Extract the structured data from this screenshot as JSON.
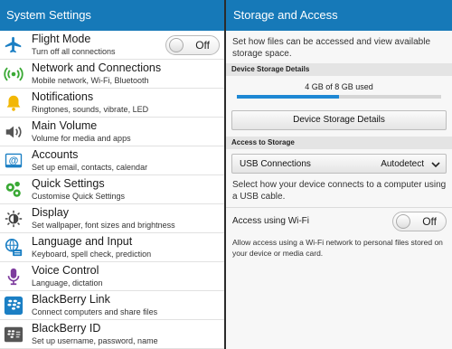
{
  "left_panel": {
    "title": "System Settings",
    "items": [
      {
        "title": "Flight Mode",
        "subtitle": "Turn off all connections",
        "icon": "airplane-icon",
        "toggle": "Off"
      },
      {
        "title": "Network and Connections",
        "subtitle": "Mobile network, Wi-Fi, Bluetooth",
        "icon": "network-icon"
      },
      {
        "title": "Notifications",
        "subtitle": "Ringtones, sounds, vibrate, LED",
        "icon": "bell-icon"
      },
      {
        "title": "Main Volume",
        "subtitle": "Volume for media and apps",
        "icon": "speaker-icon"
      },
      {
        "title": "Accounts",
        "subtitle": "Set up email, contacts, calendar",
        "icon": "at-sign-icon"
      },
      {
        "title": "Quick Settings",
        "subtitle": "Customise Quick Settings",
        "icon": "gears-icon"
      },
      {
        "title": "Display",
        "subtitle": "Set wallpaper, font sizes and brightness",
        "icon": "brightness-icon"
      },
      {
        "title": "Language and Input",
        "subtitle": "Keyboard, spell check, prediction",
        "icon": "language-keyboard-icon"
      },
      {
        "title": "Voice Control",
        "subtitle": "Language, dictation",
        "icon": "microphone-icon"
      },
      {
        "title": "BlackBerry Link",
        "subtitle": "Connect computers and share files",
        "icon": "blackberry-logo-icon"
      },
      {
        "title": "BlackBerry ID",
        "subtitle": "Set up username, password, name",
        "icon": "id-card-icon"
      }
    ]
  },
  "right_panel": {
    "title": "Storage and Access",
    "intro": "Set how files can be accessed and view available storage space.",
    "device_storage": {
      "section_label": "Device Storage Details",
      "usage_text": "4 GB of 8 GB used",
      "used_fraction": 0.5,
      "button_label": "Device Storage Details"
    },
    "access": {
      "section_label": "Access to Storage",
      "usb_label": "USB Connections",
      "usb_value": "Autodetect",
      "usb_desc": "Select how your device connects to a computer using a USB cable.",
      "wifi_label": "Access using Wi-Fi",
      "wifi_toggle": "Off",
      "wifi_desc": "Allow access using a Wi-Fi network to personal files stored on your device or media card."
    }
  },
  "colors": {
    "titlebar": "#1679b8",
    "progress": "#1e88d4",
    "icon_blue": "#1b7fc4",
    "icon_green": "#3aa935",
    "icon_yellow": "#f2b705",
    "icon_purple": "#7e3c9e"
  }
}
